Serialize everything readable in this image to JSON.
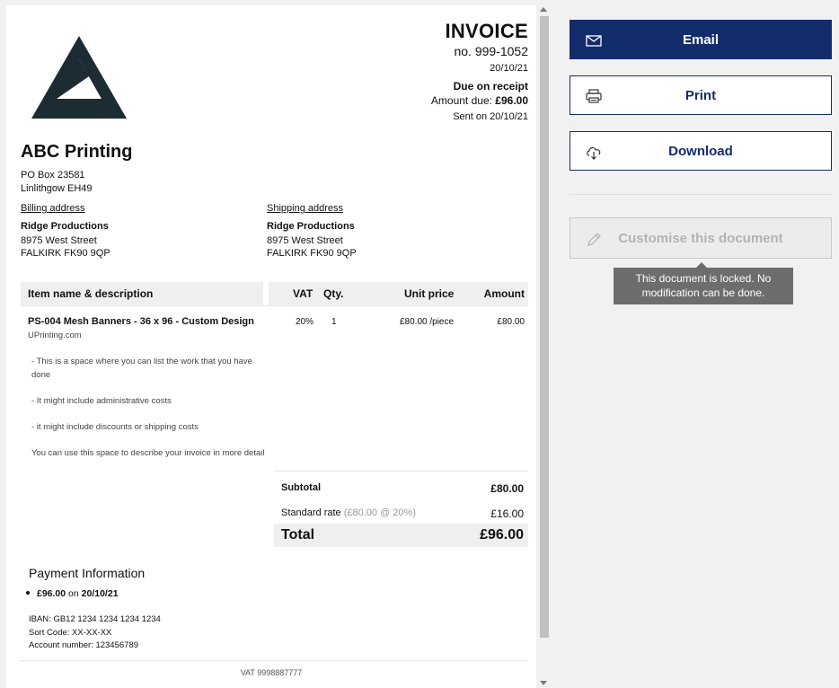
{
  "invoice": {
    "title": "INVOICE",
    "number": "no. 999-1052",
    "date": "20/10/21",
    "due": "Due on receipt",
    "amount_due_label": "Amount due: ",
    "amount_due_value": "£96.00",
    "sent": "Sent on 20/10/21"
  },
  "company": {
    "name": "ABC Printing",
    "line1": "PO Box 23581",
    "line2": "Linlithgow EH49"
  },
  "billing": {
    "title": "Billing address",
    "name": "Ridge Productions",
    "street": "8975 West Street",
    "city": "FALKIRK FK90 9QP"
  },
  "shipping": {
    "title": "Shipping address",
    "name": "Ridge Productions",
    "street": "8975 West Street",
    "city": "FALKIRK FK90 9QP"
  },
  "table": {
    "headers": {
      "item": "Item name & description",
      "vat": "VAT",
      "qty": "Qty.",
      "unit_price": "Unit price",
      "amount": "Amount"
    },
    "rows": [
      {
        "name": "PS-004 Mesh Banners - 36 x 96 - Custom Design",
        "vat": "20%",
        "qty": "1",
        "unit_price": "£80.00 /piece",
        "amount": "£80.00",
        "description": [
          "UPrinting.com",
          "- This is a space where you can list the work that you have done",
          "- It might include administrative costs",
          "- it might include discounts or shipping costs",
          "You can use this space to describe your invoice in more detail"
        ]
      }
    ]
  },
  "totals": {
    "subtotal_label": "Subtotal",
    "subtotal_value": "£80.00",
    "tax_label": "Standard rate",
    "tax_detail": "(£80.00 @ 20%)",
    "tax_value": "£16.00",
    "total_label": "Total",
    "total_value": "£96.00"
  },
  "payment": {
    "title": "Payment Information",
    "entry_amount": "£96.00",
    "entry_on": "on",
    "entry_date": "20/10/21",
    "iban": "IBAN: GB12 1234 1234 1234 1234",
    "sort_code": "Sort Code: XX-XX-XX",
    "account": "Account number: 123456789"
  },
  "footer": {
    "vat": "VAT 9998887777"
  },
  "actions": {
    "email": "Email",
    "print": "Print",
    "download": "Download",
    "customise": "Customise this document",
    "locked_tooltip": "This document is locked. No modification can be done."
  },
  "colors": {
    "brand_navy": "#132c6b",
    "logo": "#1d2b33",
    "tooltip": "#6d6d6d"
  },
  "icons": {
    "email": "envelope-icon",
    "print": "printer-icon",
    "download": "cloud-download-icon",
    "customise": "pencil-icon",
    "logo": "triangle-logo"
  }
}
